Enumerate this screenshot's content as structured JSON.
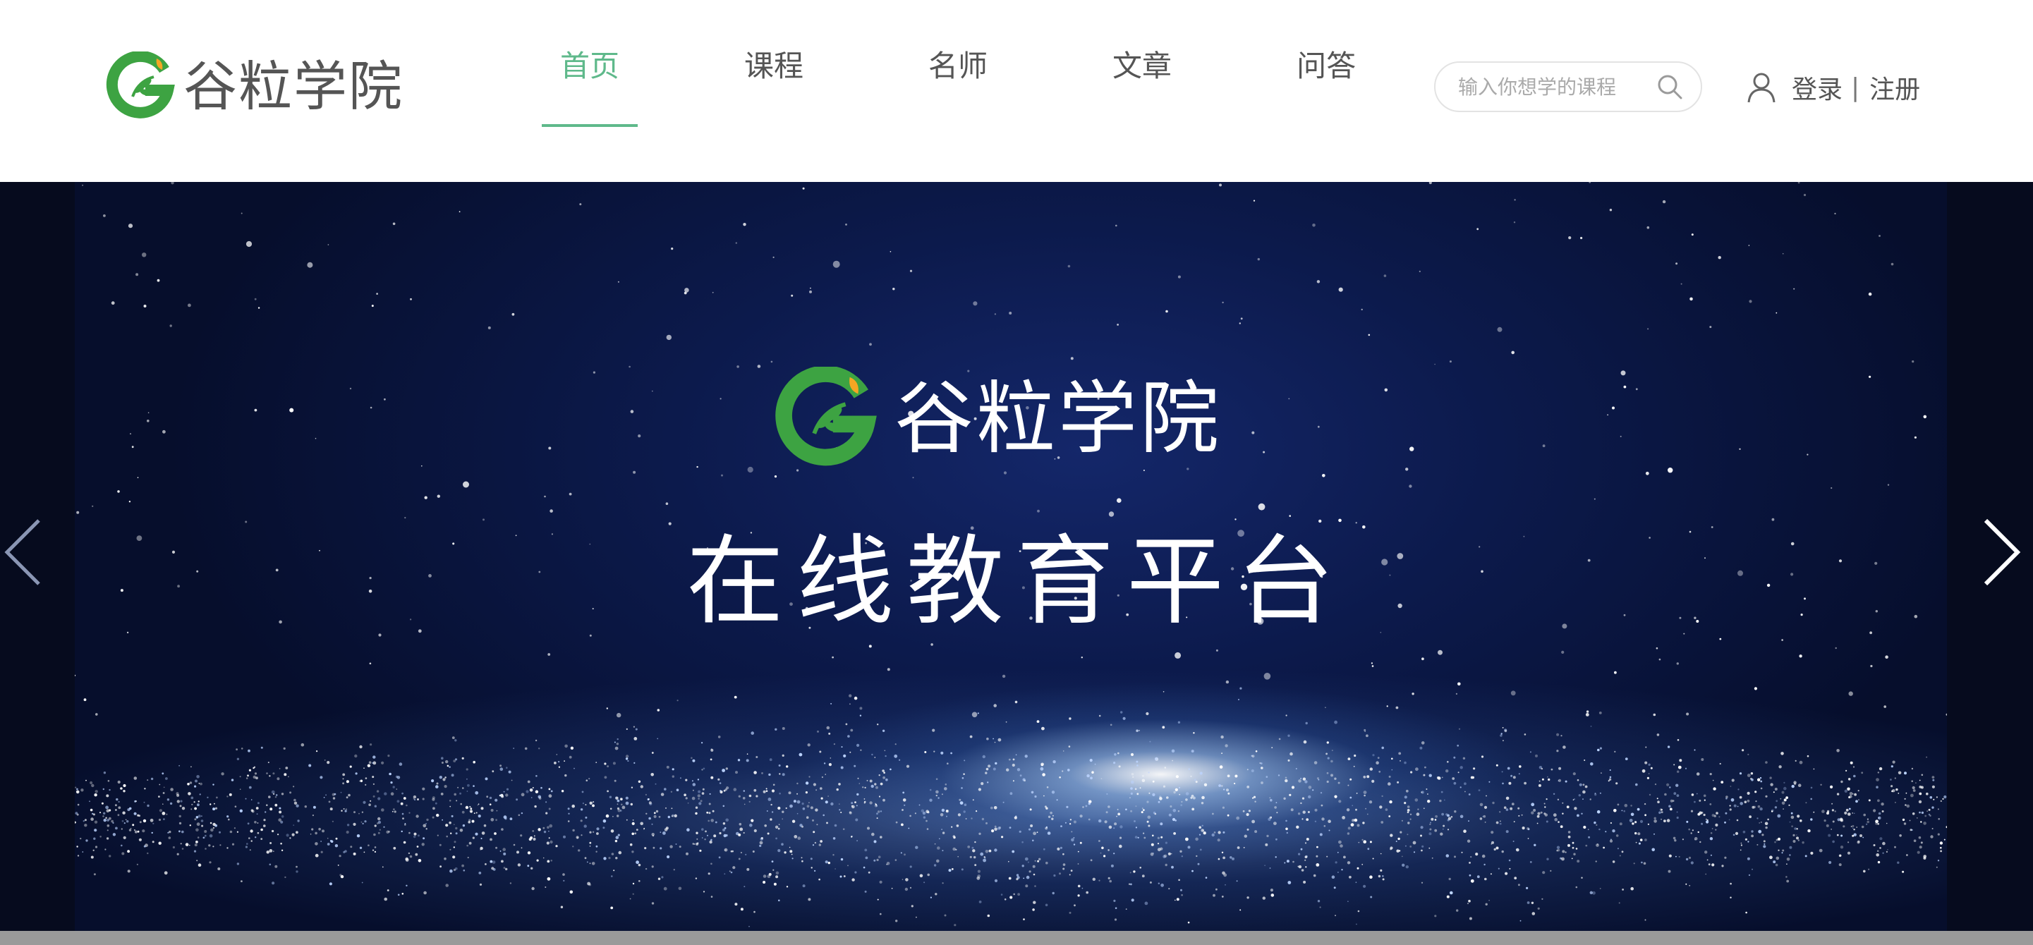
{
  "header": {
    "logo_text": "谷粒学院",
    "nav": [
      {
        "label": "首页",
        "active": true
      },
      {
        "label": "课程",
        "active": false
      },
      {
        "label": "名师",
        "active": false
      },
      {
        "label": "文章",
        "active": false
      },
      {
        "label": "问答",
        "active": false
      }
    ],
    "search": {
      "placeholder": "输入你想学的课程",
      "value": ""
    },
    "auth": {
      "login": "登录",
      "separator": "|",
      "register": "注册"
    }
  },
  "banner": {
    "logo_text": "谷粒学院",
    "tagline": "在线教育平台",
    "prev_icon": "chevron-left-icon",
    "next_icon": "chevron-right-icon"
  },
  "colors": {
    "accent": "#5fb98b",
    "brand_green": "#3da342",
    "brand_orange": "#f5a623",
    "text": "#555555",
    "banner_bg": "#0c1a4c"
  }
}
